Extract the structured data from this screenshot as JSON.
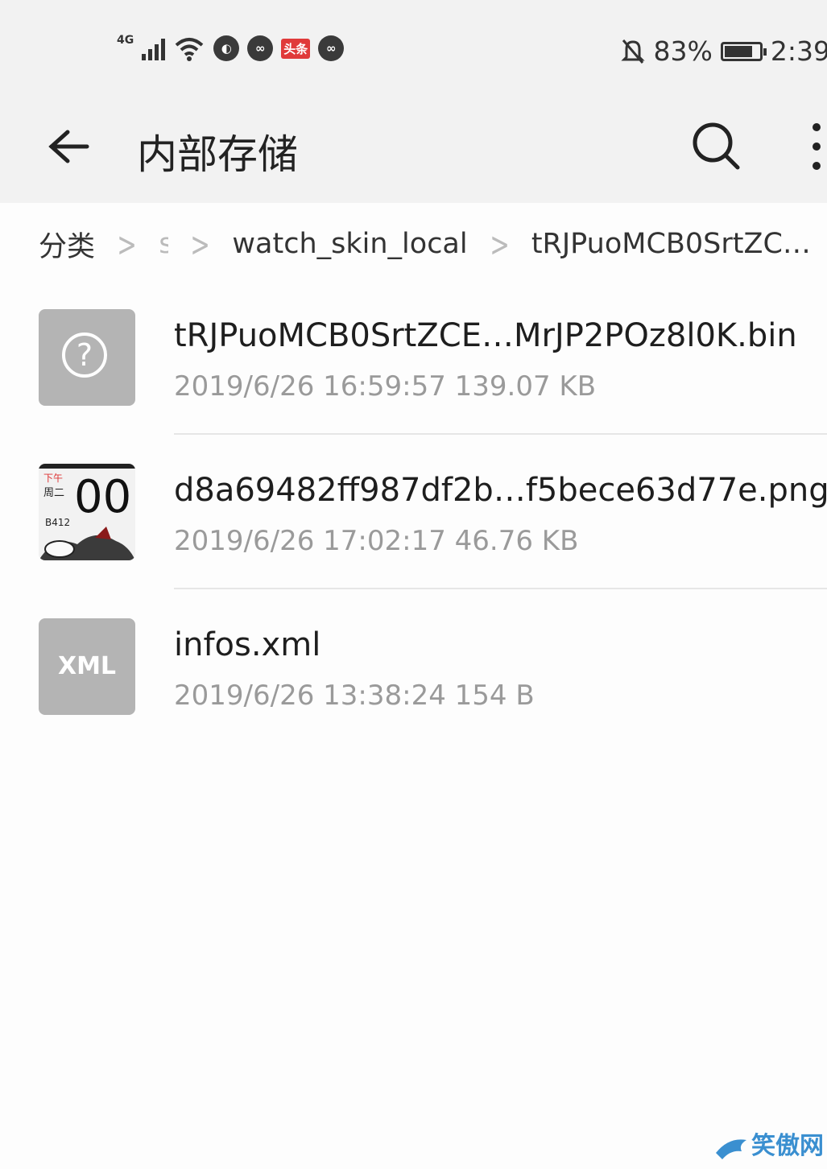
{
  "status_bar": {
    "network": "4G",
    "toutiao": "头条",
    "battery_percent": "83%",
    "time": "2:39",
    "battery_level": 0.83
  },
  "app_bar": {
    "title": "内部存储",
    "back_icon": "arrow-left-icon",
    "search_icon": "search-icon",
    "more_icon": "more-vert-icon"
  },
  "breadcrumb": {
    "items": [
      "分类",
      "s",
      "watch_skin_local",
      "tRJPuoMCB0SrtZC…"
    ]
  },
  "files": [
    {
      "name": "tRJPuoMCB0SrtZCE…MrJP2POz8l0K.bin",
      "meta": "2019/6/26 16:59:57 139.07 KB",
      "icon": "unknown-file-icon"
    },
    {
      "name": "d8a69482ff987df2b…f5bece63d77e.png",
      "meta": "2019/6/26 17:02:17 46.76 KB",
      "icon": "image-thumbnail",
      "thumb_text": [
        "下午",
        "周二",
        "00",
        "B412"
      ]
    },
    {
      "name": "infos.xml",
      "meta": "2019/6/26 13:38:24 154 B",
      "icon": "xml-file-icon",
      "icon_label": "XML"
    }
  ],
  "watermark": "笑傲网"
}
